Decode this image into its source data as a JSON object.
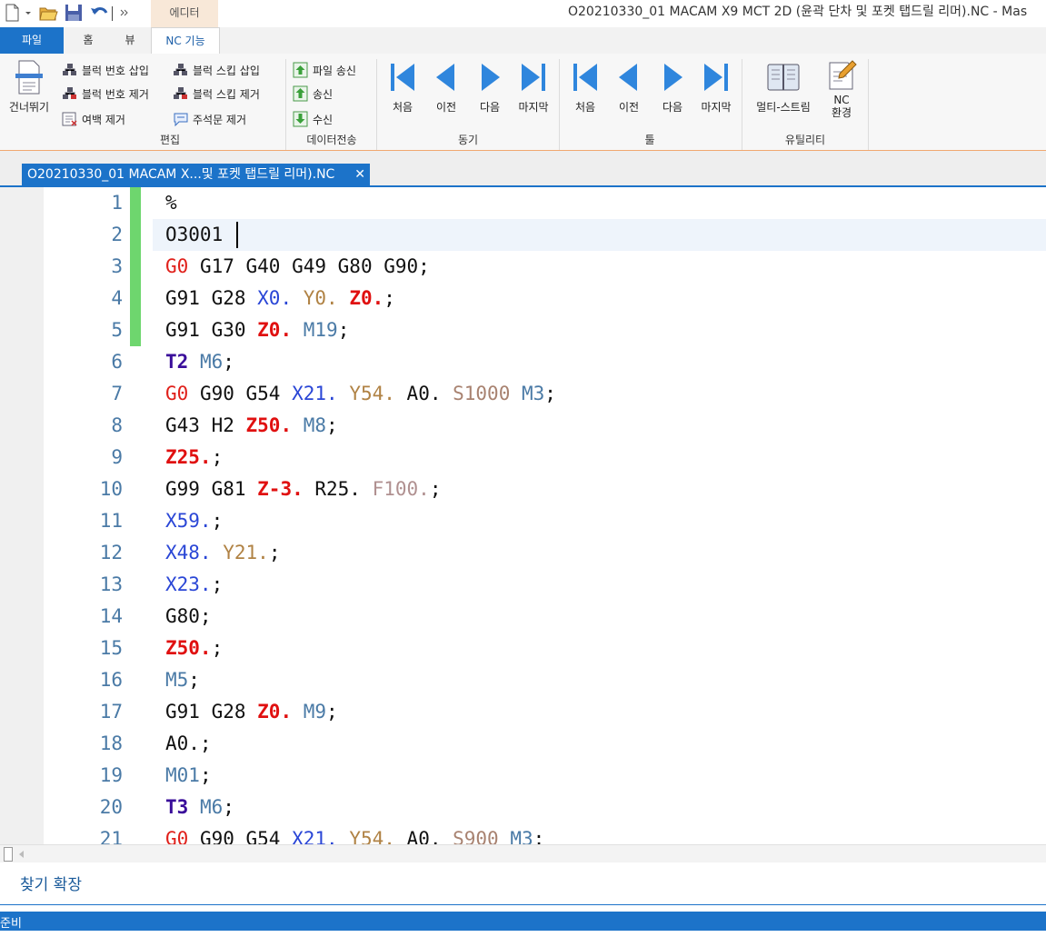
{
  "titlebar": {
    "context_tab": "에디터",
    "window_title": "O20210330_01 MACAM X9 MCT 2D (윤곽 단차 및 포켓 탭드릴 리머).NC - Mas"
  },
  "ribbon_tabs": [
    "파일",
    "홈",
    "뷰",
    "NC 기능"
  ],
  "ribbon": {
    "skip_label": "건너뛰기",
    "edit_items": [
      "블럭 번호 삽입",
      "블럭 번호 제거",
      "여백 제거",
      "블럭 스킵 삽입",
      "블럭 스킵 제거",
      "주석문 제거"
    ],
    "edit_group": "편집",
    "transfer_items": [
      "파일 송신",
      "송신",
      "수신"
    ],
    "transfer_group": "데이터전송",
    "sync_items": [
      "처음",
      "이전",
      "다음",
      "마지막"
    ],
    "sync_group": "동기",
    "tool_items": [
      "처음",
      "이전",
      "다음",
      "마지막"
    ],
    "tool_group": "툴",
    "util_items": [
      "멀티-스트림",
      "NC",
      "환경"
    ],
    "util_group": "유틸리티"
  },
  "document_tab": {
    "title": "O20210330_01 MACAM X...및 포켓 탭드릴 리머).NC",
    "close": "✕"
  },
  "colors": {
    "accent": "#1c73c9",
    "change_bar": "#6ed66e"
  },
  "code_lines": [
    {
      "n": "1",
      "t": [
        [
          "%",
          ""
        ]
      ]
    },
    {
      "n": "2",
      "t": [
        [
          "O3001",
          ""
        ]
      ]
    },
    {
      "n": "3",
      "t": [
        [
          "G0",
          "g0"
        ],
        [
          " G17 G40 G49 G80 G90;",
          ""
        ]
      ]
    },
    {
      "n": "4",
      "t": [
        [
          "G91 G28 ",
          ""
        ],
        [
          "X0.",
          "x"
        ],
        [
          " ",
          ""
        ],
        [
          "Y0.",
          "y"
        ],
        [
          " ",
          ""
        ],
        [
          "Z0.",
          "z"
        ],
        [
          ";",
          ""
        ]
      ]
    },
    {
      "n": "5",
      "t": [
        [
          "G91 G30 ",
          ""
        ],
        [
          "Z0.",
          "z"
        ],
        [
          " ",
          ""
        ],
        [
          "M19",
          "m"
        ],
        [
          ";",
          ""
        ]
      ]
    },
    {
      "n": "6",
      "t": [
        [
          "T2",
          "t"
        ],
        [
          " ",
          ""
        ],
        [
          "M6",
          "m"
        ],
        [
          ";",
          ""
        ]
      ]
    },
    {
      "n": "7",
      "t": [
        [
          "G0",
          "g0"
        ],
        [
          " G90 G54 ",
          ""
        ],
        [
          "X21.",
          "x"
        ],
        [
          " ",
          ""
        ],
        [
          "Y54.",
          "y"
        ],
        [
          " A0. ",
          ""
        ],
        [
          "S1000",
          "s"
        ],
        [
          " ",
          ""
        ],
        [
          "M3",
          "m"
        ],
        [
          ";",
          ""
        ]
      ]
    },
    {
      "n": "8",
      "t": [
        [
          "G43 H2 ",
          ""
        ],
        [
          "Z50.",
          "z"
        ],
        [
          " ",
          ""
        ],
        [
          "M8",
          "m"
        ],
        [
          ";",
          ""
        ]
      ]
    },
    {
      "n": "9",
      "t": [
        [
          "Z25.",
          "z"
        ],
        [
          ";",
          ""
        ]
      ]
    },
    {
      "n": "10",
      "t": [
        [
          "G99 G81 ",
          ""
        ],
        [
          "Z-3.",
          "z"
        ],
        [
          " R25. ",
          ""
        ],
        [
          "F100.",
          "f"
        ],
        [
          ";",
          ""
        ]
      ]
    },
    {
      "n": "11",
      "t": [
        [
          "X59.",
          "x"
        ],
        [
          ";",
          ""
        ]
      ]
    },
    {
      "n": "12",
      "t": [
        [
          "X48.",
          "x"
        ],
        [
          " ",
          ""
        ],
        [
          "Y21.",
          "y"
        ],
        [
          ";",
          ""
        ]
      ]
    },
    {
      "n": "13",
      "t": [
        [
          "X23.",
          "x"
        ],
        [
          ";",
          ""
        ]
      ]
    },
    {
      "n": "14",
      "t": [
        [
          "G80;",
          ""
        ]
      ]
    },
    {
      "n": "15",
      "t": [
        [
          "Z50.",
          "z"
        ],
        [
          ";",
          ""
        ]
      ]
    },
    {
      "n": "16",
      "t": [
        [
          "M5",
          "m"
        ],
        [
          ";",
          ""
        ]
      ]
    },
    {
      "n": "17",
      "t": [
        [
          "G91 G28 ",
          ""
        ],
        [
          "Z0.",
          "z"
        ],
        [
          " ",
          ""
        ],
        [
          "M9",
          "m"
        ],
        [
          ";",
          ""
        ]
      ]
    },
    {
      "n": "18",
      "t": [
        [
          "A0.;",
          ""
        ]
      ]
    },
    {
      "n": "19",
      "t": [
        [
          "M01",
          "m"
        ],
        [
          ";",
          ""
        ]
      ]
    },
    {
      "n": "20",
      "t": [
        [
          "T3",
          "t"
        ],
        [
          " ",
          ""
        ],
        [
          "M6",
          "m"
        ],
        [
          ";",
          ""
        ]
      ]
    },
    {
      "n": "21",
      "t": [
        [
          "G0",
          "g0"
        ],
        [
          " G90 G54 ",
          ""
        ],
        [
          "X21.",
          "x"
        ],
        [
          " ",
          ""
        ],
        [
          "Y54.",
          "y"
        ],
        [
          " A0. ",
          ""
        ],
        [
          "S900",
          "s"
        ],
        [
          " ",
          ""
        ],
        [
          "M3",
          "m"
        ],
        [
          ";",
          ""
        ]
      ]
    }
  ],
  "find": {
    "label": "찾기 확장"
  },
  "status": {
    "text": "준비"
  }
}
